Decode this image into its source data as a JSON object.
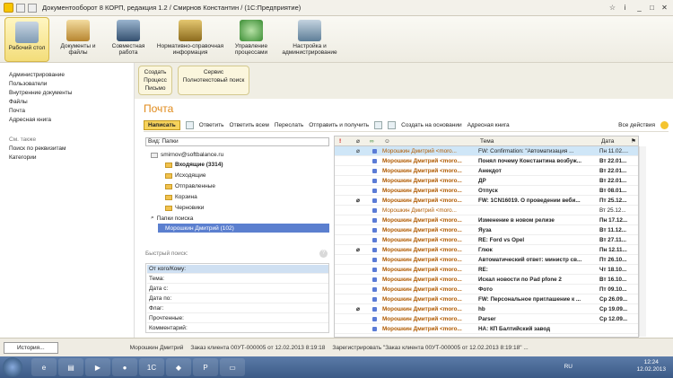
{
  "window": {
    "title": "Документооборот 8 КОРП, редакция 1.2 / Смирнов Константин / (1С:Предприятие)"
  },
  "ribbon": [
    {
      "label": "Рабочий стол",
      "icon": "desk-icon"
    },
    {
      "label": "Документы и файлы",
      "icon": "documents-icon"
    },
    {
      "label": "Совместная работа",
      "icon": "people-icon"
    },
    {
      "label": "Нормативно-справочная информация",
      "icon": "books-icon"
    },
    {
      "label": "Управление процессами",
      "icon": "process-icon"
    },
    {
      "label": "Настройка и администрирование",
      "icon": "settings-icon"
    }
  ],
  "subbar": {
    "create": {
      "title": "Создать",
      "items": [
        "Процесс",
        "Письмо"
      ]
    },
    "service": {
      "title": "Сервис",
      "items": [
        "Полнотекстовый поиск"
      ]
    }
  },
  "left": {
    "items": [
      "Администрирование",
      "Пользователи",
      "Внутренние документы",
      "Файлы",
      "Почта",
      "Адресная книга"
    ],
    "see_also": "См. также",
    "see_items": [
      "Поиск по реквизитам",
      "Категории"
    ]
  },
  "page": {
    "title": "Почта"
  },
  "toolbar": {
    "write": "Написать",
    "reply": "Ответить",
    "reply_all": "Ответить всем",
    "forward": "Переслать",
    "send_receive": "Отправить и получить",
    "create_based": "Создать на основании",
    "address_book": "Адресная книга",
    "all_actions": "Все действия"
  },
  "folders": {
    "view_label": "Вид: Папки",
    "account": "smirnov@softbalance.ru",
    "inbox": "Входящие (3314)",
    "outgoing": "Исходящие",
    "sent": "Отправленные",
    "trash": "Корзина",
    "drafts": "Черновики",
    "search_folders": "Папки поиска",
    "search_item": "Морошкин Дмитрий (102)"
  },
  "quick_search": {
    "title": "Быстрый поиск:",
    "fields": [
      "От кого/Кому:",
      "Тема:",
      "Дата с:",
      "Дата по:",
      "Флаг:",
      "Прочтенные:",
      "Комментарий:"
    ]
  },
  "grid": {
    "headers": {
      "importance": "!",
      "subject": "Тема",
      "date": "Дата"
    },
    "rows": [
      {
        "from": "Морошкин Дмитрий <moro...",
        "subject": "FW: Confirmation: \"Автоматизация ...",
        "date": "Пн 11.02....",
        "clip": true,
        "bold": false,
        "sel": true
      },
      {
        "from": "Морошкин Дмитрий <moro...",
        "subject": "Понял почему Константина возбуж...",
        "date": "Вт 22.01...",
        "clip": false,
        "bold": true,
        "sel": false
      },
      {
        "from": "Морошкин Дмитрий <moro...",
        "subject": "Анекдот",
        "date": "Вт 22.01...",
        "clip": false,
        "bold": true,
        "sel": false
      },
      {
        "from": "Морошкин Дмитрий <moro...",
        "subject": "ДР",
        "date": "Вт 22.01...",
        "clip": false,
        "bold": true,
        "sel": false
      },
      {
        "from": "Морошкин Дмитрий <moro...",
        "subject": "Отпуск",
        "date": "Вт 08.01...",
        "clip": false,
        "bold": true,
        "sel": false
      },
      {
        "from": "Морошкин Дмитрий <moro...",
        "subject": "FW: 1CN16019. О проведении веби...",
        "date": "Пт 25.12...",
        "clip": true,
        "bold": true,
        "sel": false
      },
      {
        "from": "Морошкин Дмитрий <moro...",
        "subject": "",
        "date": "Вт 25.12...",
        "clip": false,
        "bold": false,
        "sel": false
      },
      {
        "from": "Морошкин Дмитрий <moro...",
        "subject": "Изменение в новом релизе",
        "date": "Пн 17.12...",
        "clip": false,
        "bold": true,
        "sel": false
      },
      {
        "from": "Морошкин Дмитрий <moro...",
        "subject": "Яуза",
        "date": "Вт 11.12...",
        "clip": false,
        "bold": true,
        "sel": false
      },
      {
        "from": "Морошкин Дмитрий <moro...",
        "subject": "RE: Ford vs Opel",
        "date": "Вт 27.11...",
        "clip": false,
        "bold": true,
        "sel": false
      },
      {
        "from": "Морошкин Дмитрий <moro...",
        "subject": "Глюк",
        "date": "Пн 12.11...",
        "clip": true,
        "bold": true,
        "sel": false
      },
      {
        "from": "Морошкин Дмитрий <moro...",
        "subject": "Автоматический ответ: министр св...",
        "date": "Пт 26.10...",
        "clip": false,
        "bold": true,
        "sel": false
      },
      {
        "from": "Морошкин Дмитрий <moro...",
        "subject": "RE:",
        "date": "Чт 18.10...",
        "clip": false,
        "bold": true,
        "sel": false
      },
      {
        "from": "Морошкин Дмитрий <moro...",
        "subject": "Искал новости по Pad pfone 2",
        "date": "Вт 16.10...",
        "clip": false,
        "bold": true,
        "sel": false
      },
      {
        "from": "Морошкин Дмитрий <moro...",
        "subject": "Фото",
        "date": "Пт 09.10...",
        "clip": false,
        "bold": true,
        "sel": false
      },
      {
        "from": "Морошкин Дмитрий <moro...",
        "subject": "FW: Персональное приглашение к ...",
        "date": "Ср 26.09...",
        "clip": false,
        "bold": true,
        "sel": false
      },
      {
        "from": "Морошкин Дмитрий <moro...",
        "subject": "hb",
        "date": "Ср 19.09...",
        "clip": true,
        "bold": true,
        "sel": false
      },
      {
        "from": "Морошкин Дмитрий <moro...",
        "subject": "Parser",
        "date": "Ср 12.09...",
        "clip": false,
        "bold": true,
        "sel": false
      },
      {
        "from": "Морошкин Дмитрий <moro...",
        "subject": "НА: КП Балтийский завод",
        "date": "",
        "clip": false,
        "bold": true,
        "sel": false
      }
    ]
  },
  "statusbar": {
    "history": "История...",
    "tabs": [
      "Морошкин Дмитрий",
      "Заказ клиента 00УТ-000005 от 12.02.2013 8:19:18",
      "Зарегистрировать \"Заказ клиента 00УТ-000005 от 12.02.2013 8:19:18\" ..."
    ]
  },
  "taskbar": {
    "lang": "RU",
    "time": "12:24",
    "date": "12.02.2013"
  }
}
